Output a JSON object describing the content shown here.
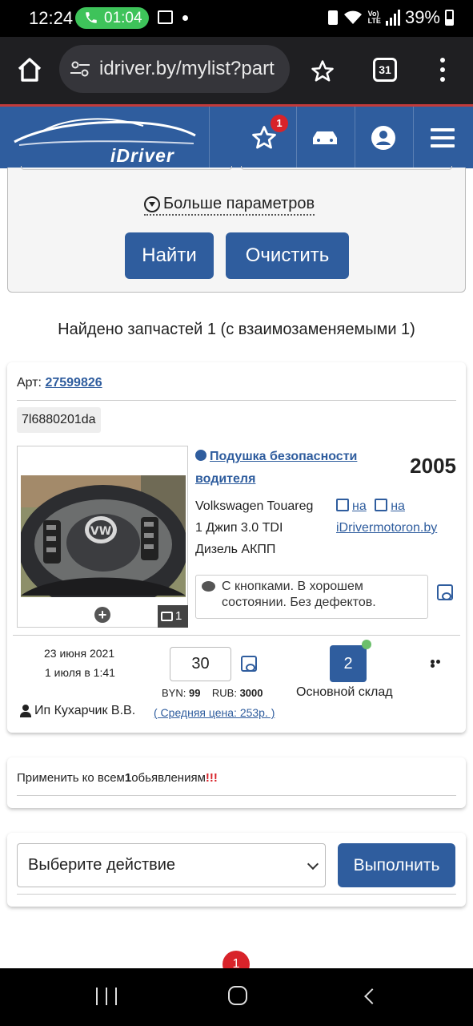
{
  "status_bar": {
    "time": "12:24",
    "call_timer": "01:04",
    "battery": "39%"
  },
  "browser": {
    "url": "idriver.by/mylist?part",
    "tab_count": "31"
  },
  "header": {
    "logo_text": "iDriver",
    "favorites_badge": "1"
  },
  "filter": {
    "more_params": "Больше параметров",
    "find_button": "Найти",
    "clear_button": "Очистить"
  },
  "results": {
    "found_text": "Найдено запчастей 1 (с взаимозаменяемыми 1)"
  },
  "part": {
    "art_label": "Арт:",
    "art_number": "27599826",
    "code": "7l6880201da",
    "photo_count": "1",
    "title": "Подушка безопасности водителя",
    "year": "2005",
    "car_line1": "Volkswagen Touareg",
    "car_line2": "1 Джип 3.0 TDI",
    "car_line3": "Дизель АКПП",
    "link1_label": "на",
    "link2_label": "на",
    "link_site": "iDrivermotoron.by",
    "comment": "С кнопками. В хорошем состоянии. Без дефектов.",
    "date_added": "23 июня 2021",
    "date_updated": "1 июля в 1:41",
    "seller": "Ип Кухарчик В.В.",
    "quantity": "30",
    "price_byn_label": "BYN:",
    "price_byn": "99",
    "price_rub_label": "RUB:",
    "price_rub": "3000",
    "avg_price": "( Средняя цена: 253р. )",
    "stock_count": "2",
    "stock_label": "Основной склад"
  },
  "apply_all": {
    "text_before": "Применить ко всем",
    "count": "1",
    "text_after": "обьявлениям",
    "exclaim": "!!!"
  },
  "action": {
    "select_value": "Выберите действие",
    "execute_button": "Выполнить"
  },
  "bottom_badge": "1",
  "colors": {
    "brand_blue": "#2f5d9e",
    "badge_red": "#d8232a"
  }
}
